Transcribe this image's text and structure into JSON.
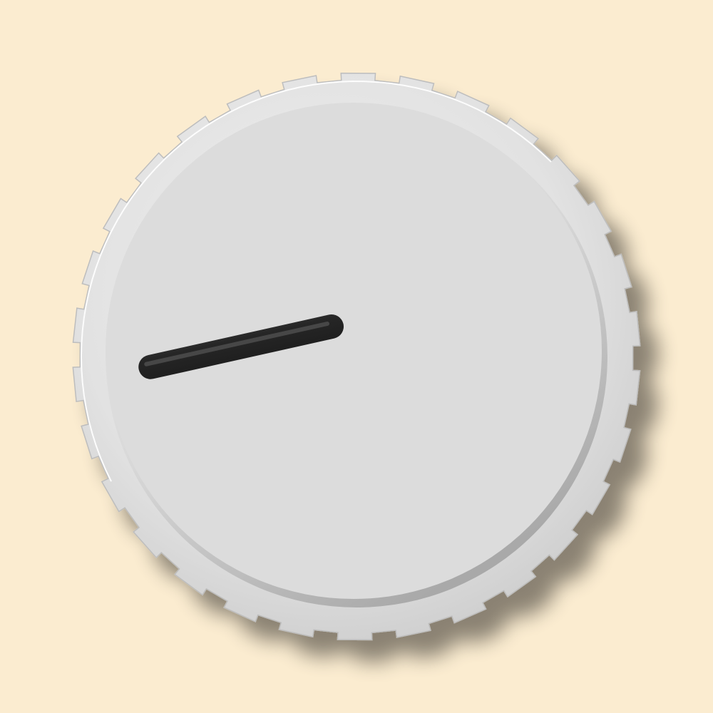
{
  "colors": {
    "background": "#fbecd0",
    "rim": "#e4e4e4",
    "rim_highlight": "#ffffff",
    "rim_shadow": "#b9b9b9",
    "cap_face": "#dcdcdc",
    "indicator": "#262626"
  },
  "knob": {
    "control": "rotary-knob",
    "indicator_icon": "line-pointer-icon",
    "level_fraction": 0.12
  }
}
